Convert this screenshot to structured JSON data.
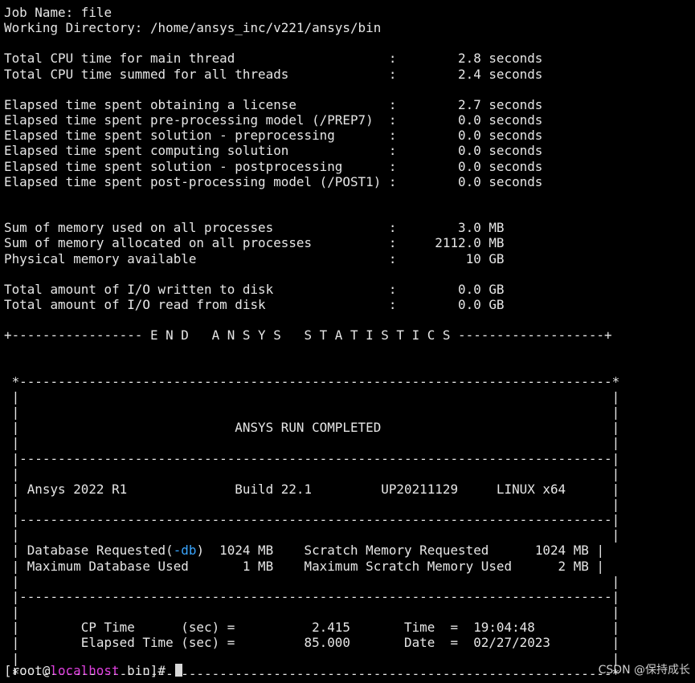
{
  "terminal": {
    "job_name_line": "Job Name: file",
    "working_dir_line": "Working Directory: /home/ansys_inc/v221/ansys/bin",
    "cpu_main_line": "Total CPU time for main thread                    :        2.8 seconds",
    "cpu_all_line": "Total CPU time summed for all threads             :        2.4 seconds",
    "elapsed_license_line": "Elapsed time spent obtaining a license            :        2.7 seconds",
    "elapsed_prep_line": "Elapsed time spent pre-processing model (/PREP7)  :        0.0 seconds",
    "elapsed_sol_pre_line": "Elapsed time spent solution - preprocessing       :        0.0 seconds",
    "elapsed_compute_line": "Elapsed time spent computing solution             :        0.0 seconds",
    "elapsed_sol_post_line": "Elapsed time spent solution - postprocessing      :        0.0 seconds",
    "elapsed_post_line": "Elapsed time spent post-processing model (/POST1) :        0.0 seconds",
    "mem_used_line": "Sum of memory used on all processes               :        3.0 MB",
    "mem_alloc_line": "Sum of memory allocated on all processes          :     2112.0 MB",
    "phys_mem_line": "Physical memory available                         :         10 GB",
    "io_written_line": "Total amount of I/O written to disk               :        0.0 GB",
    "io_read_line": "Total amount of I/O read from disk                :        0.0 GB",
    "stats_footer_line": "+----------------- E N D   A N S Y S   S T A T I S T I C S -------------------+",
    "box_top_line": " *-----------------------------------------------------------------------------*",
    "box_empty_line": " |                                                                             |",
    "box_title_line": " |                            ANSYS RUN COMPLETED                              |",
    "box_divider_line": " |-----------------------------------------------------------------------------|",
    "box_version_line": " | Ansys 2022 R1              Build 22.1         UP20211129     LINUX x64      |",
    "box_db_req_prefix": " | Database Requested(",
    "box_db_req_flag": "-db",
    "box_db_req_suffix": ")  1024 MB    Scratch Memory Requested      1024 MB |",
    "box_db_used_line": " | Maximum Database Used       1 MB    Maximum Scratch Memory Used      2 MB |",
    "box_cp_time_line": " |        CP Time      (sec) =          2.415       Time  =  19:04:48          |",
    "box_elapsed_line": " |        Elapsed Time (sec) =         85.000       Date  =  02/27/2023        |",
    "box_bottom_line": " *-----------------------------------------------------------------------------*"
  },
  "prompt": {
    "open": "[root@",
    "host": "localhost",
    "rest": " bin]#"
  },
  "watermark": "CSDN @保持成长",
  "colors": {
    "background": "#000000",
    "text": "#e6e6e6",
    "db_flag": "#3aa6ff",
    "prompt_host": "#e040e0"
  }
}
